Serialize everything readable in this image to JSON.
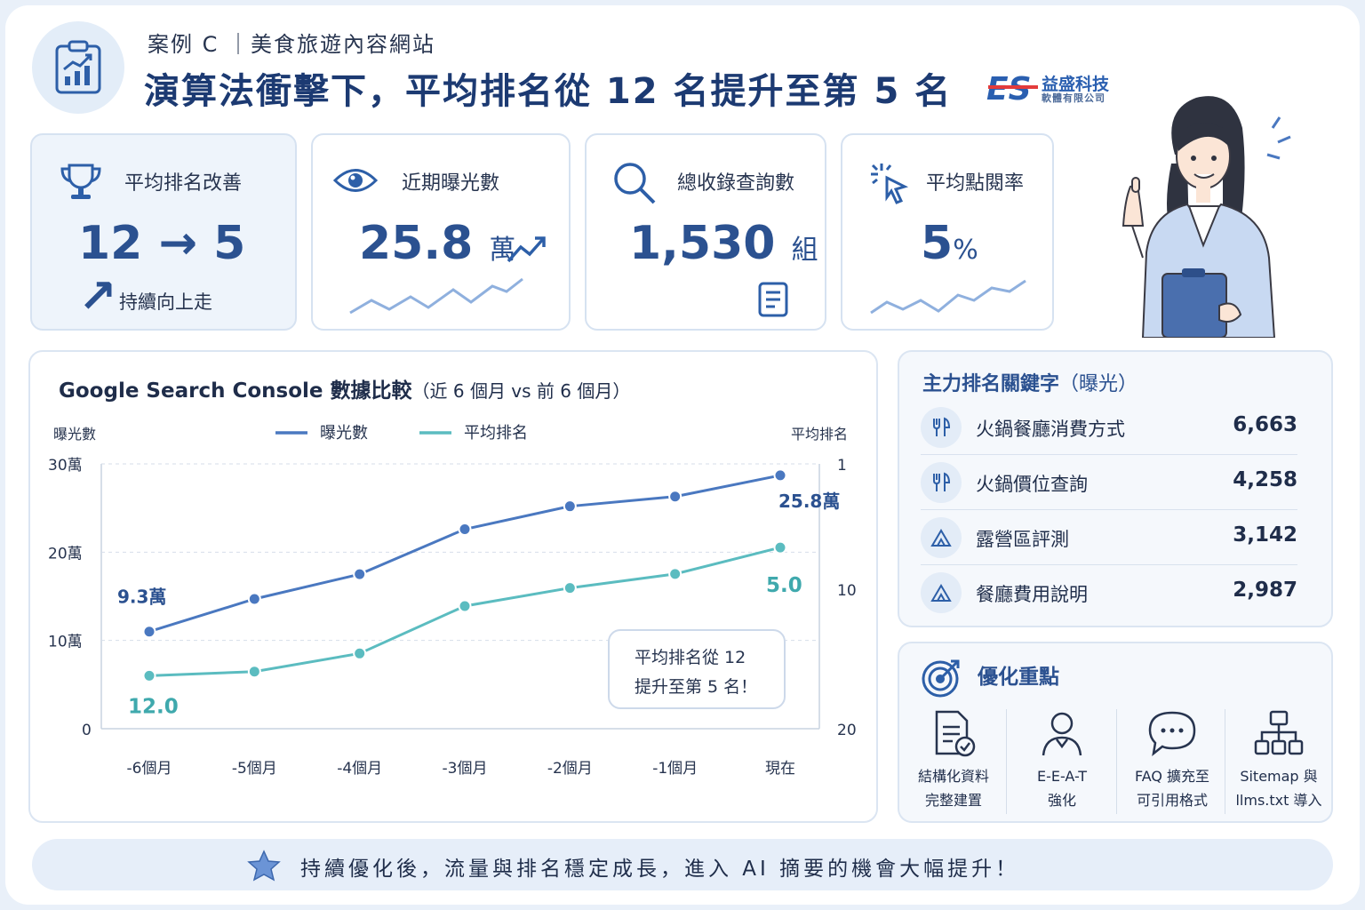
{
  "header": {
    "case_label": "案例 C ｜美食旅遊內容網站",
    "title": "演算法衝擊下，平均排名從 12 名提升至第 5 名",
    "logo_name": "益盛科技",
    "logo_sub": "軟體有限公司",
    "logo_mark": "ES"
  },
  "kpis": {
    "rank": {
      "label": "平均排名改善",
      "value": "12 → 5 ↗",
      "sub": "持續向上走"
    },
    "impressions": {
      "label": "近期曝光數",
      "value": "25.8",
      "unit": "萬"
    },
    "queries": {
      "label": "總收錄查詢數",
      "value": "1,530",
      "unit": "組"
    },
    "ctr": {
      "label": "平均點閱率",
      "value": "5",
      "unit": "%"
    }
  },
  "chart": {
    "title": "Google Search Console 數據比較",
    "title_paren": "（近 6 個月 vs 前 6 個月）",
    "callout_line1": "平均排名從 12",
    "callout_line2": "提升至第 5 名！"
  },
  "chart_data": {
    "type": "line",
    "x": [
      "-6個月",
      "-5個月",
      "-4個月",
      "-3個月",
      "-2個月",
      "-1個月",
      "現在"
    ],
    "left_axis": {
      "label": "曝光數",
      "ticks": [
        "0",
        "10萬",
        "20萬",
        "30萬"
      ],
      "range": [
        0,
        30
      ]
    },
    "right_axis": {
      "label": "平均排名",
      "ticks": [
        "1",
        "10",
        "20"
      ],
      "range": [
        20,
        1
      ],
      "inverted": true
    },
    "grid": true,
    "legend_position": "top-center",
    "series": [
      {
        "name": "曝光數",
        "axis": "left",
        "color": "#4a78c0",
        "values": [
          11,
          14.7,
          17.5,
          22.6,
          25.2,
          26.3,
          28.7
        ],
        "start_label": "9.3萬",
        "end_label": "25.8萬"
      },
      {
        "name": "平均排名",
        "axis": "right",
        "color": "#5bbcc0",
        "values": [
          16.2,
          15.9,
          14.6,
          11.2,
          9.9,
          8.9,
          7.0
        ],
        "start_label": "12.0",
        "end_label": "5.0"
      }
    ]
  },
  "keywords": {
    "title": "主力排名關鍵字",
    "title_paren": "（曝光）",
    "items": [
      {
        "name": "火鍋餐廳消費方式",
        "value": "6,663",
        "icon": "utensils-icon"
      },
      {
        "name": "火鍋價位查詢",
        "value": "4,258",
        "icon": "utensils-icon"
      },
      {
        "name": "露營區評測",
        "value": "3,142",
        "icon": "tent-icon"
      },
      {
        "name": "餐廳費用說明",
        "value": "2,987",
        "icon": "tent-icon"
      }
    ]
  },
  "optimization": {
    "title": "優化重點",
    "items": [
      {
        "line1": "結構化資料",
        "line2": "完整建置",
        "icon": "document-check-icon"
      },
      {
        "line1": "E-E-A-T",
        "line2": "強化",
        "icon": "person-icon"
      },
      {
        "line1": "FAQ 擴充至",
        "line2": "可引用格式",
        "icon": "chat-bubble-icon"
      },
      {
        "line1": "Sitemap 與",
        "line2": "llms.txt 導入",
        "icon": "sitemap-icon"
      }
    ]
  },
  "footer": {
    "text": "持續優化後，流量與排名穩定成長，進入 AI 摘要的機會大幅提升！"
  },
  "colors": {
    "primary": "#2b5190",
    "series_impressions": "#4a78c0",
    "series_rank": "#5bbcc0",
    "panel_bg": "#f5f8fc"
  }
}
